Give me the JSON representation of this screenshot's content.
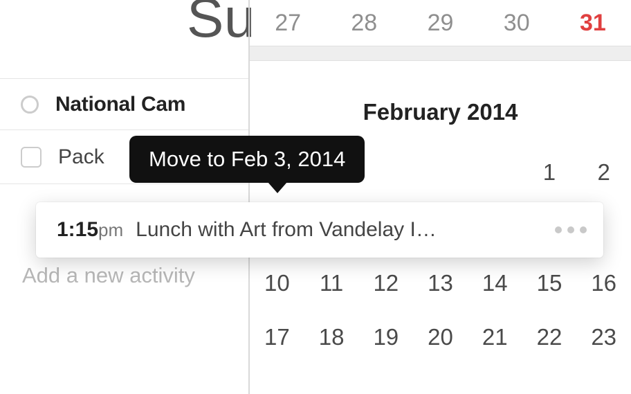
{
  "header": {
    "title_fragment": "Su"
  },
  "activities": {
    "items": [
      {
        "label": "National Cam",
        "completed": false,
        "kind": "heading"
      },
      {
        "label": "Pack",
        "completed": false,
        "kind": "task"
      }
    ],
    "add_placeholder": "Add a new activity"
  },
  "dragged_event": {
    "time_main": "1:15",
    "time_suffix": "pm",
    "title": "Lunch with Art from Vandelay I…"
  },
  "tooltip": {
    "text": "Move to Feb 3, 2014"
  },
  "calendar": {
    "prev_trailing": [
      "27",
      "28",
      "29",
      "30",
      "31"
    ],
    "today_value": "31",
    "month_label": "February 2014",
    "week1": [
      "",
      "",
      "",
      "",
      "",
      "1",
      "2"
    ],
    "week2": [
      "10",
      "11",
      "12",
      "13",
      "14",
      "15",
      "16"
    ],
    "week3": [
      "17",
      "18",
      "19",
      "20",
      "21",
      "22",
      "23"
    ]
  }
}
